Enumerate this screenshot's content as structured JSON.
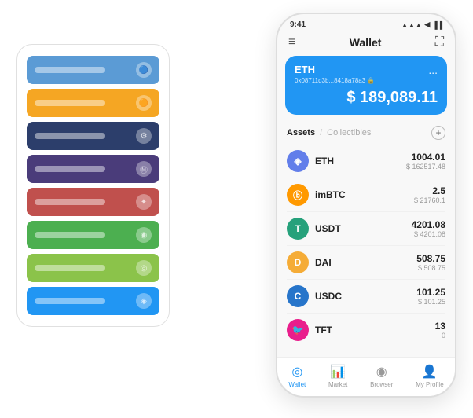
{
  "scene": {
    "cardStack": {
      "cards": [
        {
          "color": "#5B9BD5",
          "labelColor": "rgba(255,255,255,0.4)",
          "iconSymbol": "🔵"
        },
        {
          "color": "#F5A623",
          "labelColor": "rgba(255,255,255,0.4)",
          "iconSymbol": "🟠"
        },
        {
          "color": "#2C3E6B",
          "labelColor": "rgba(255,255,255,0.4)",
          "iconSymbol": "⚙"
        },
        {
          "color": "#4A3C7A",
          "labelColor": "rgba(255,255,255,0.4)",
          "iconSymbol": "Ⓜ"
        },
        {
          "color": "#C0504D",
          "labelColor": "rgba(255,255,255,0.4)",
          "iconSymbol": "✦"
        },
        {
          "color": "#4CAF50",
          "labelColor": "rgba(255,255,255,0.4)",
          "iconSymbol": "◉"
        },
        {
          "color": "#8BC34A",
          "labelColor": "rgba(255,255,255,0.4)",
          "iconSymbol": "◎"
        },
        {
          "color": "#2196F3",
          "labelColor": "rgba(255,255,255,0.4)",
          "iconSymbol": "◈"
        }
      ]
    },
    "phone": {
      "statusBar": {
        "time": "9:41",
        "icons": "▲ ◀ ▐▐▐"
      },
      "topNav": {
        "menuIcon": "≡",
        "title": "Wallet",
        "expandIcon": "⛶"
      },
      "blueCard": {
        "coinName": "ETH",
        "address": "0x08711d3b...8418a78a3 🔒",
        "balance": "$ 189,089.11",
        "moreIcon": "..."
      },
      "assetsSection": {
        "activeTab": "Assets",
        "divider": "/",
        "inactiveTab": "Collectibles",
        "addIconLabel": "+"
      },
      "assets": [
        {
          "name": "ETH",
          "iconColor": "#627EEA",
          "iconSymbol": "◈",
          "iconEmoji": "🔷",
          "amount": "1004.01",
          "usd": "$ 162517.48"
        },
        {
          "name": "imBTC",
          "iconColor": "#FF9900",
          "iconSymbol": "◉",
          "iconEmoji": "🟡",
          "amount": "2.5",
          "usd": "$ 21760.1"
        },
        {
          "name": "USDT",
          "iconColor": "#26A17B",
          "iconSymbol": "Ⓣ",
          "iconEmoji": "💚",
          "amount": "4201.08",
          "usd": "$ 4201.08"
        },
        {
          "name": "DAI",
          "iconColor": "#F5AC37",
          "iconSymbol": "◈",
          "iconEmoji": "🟠",
          "amount": "508.75",
          "usd": "$ 508.75"
        },
        {
          "name": "USDC",
          "iconColor": "#2775CA",
          "iconSymbol": "⊕",
          "iconEmoji": "🔵",
          "amount": "101.25",
          "usd": "$ 101.25"
        },
        {
          "name": "TFT",
          "iconColor": "#E91E8C",
          "iconSymbol": "🐦",
          "iconEmoji": "🌺",
          "amount": "13",
          "usd": "0"
        }
      ],
      "bottomNav": [
        {
          "id": "wallet",
          "label": "Wallet",
          "icon": "◎",
          "active": true
        },
        {
          "id": "market",
          "label": "Market",
          "icon": "📈",
          "active": false
        },
        {
          "id": "browser",
          "label": "Browser",
          "icon": "◉",
          "active": false
        },
        {
          "id": "profile",
          "label": "My Profile",
          "icon": "👤",
          "active": false
        }
      ]
    }
  }
}
